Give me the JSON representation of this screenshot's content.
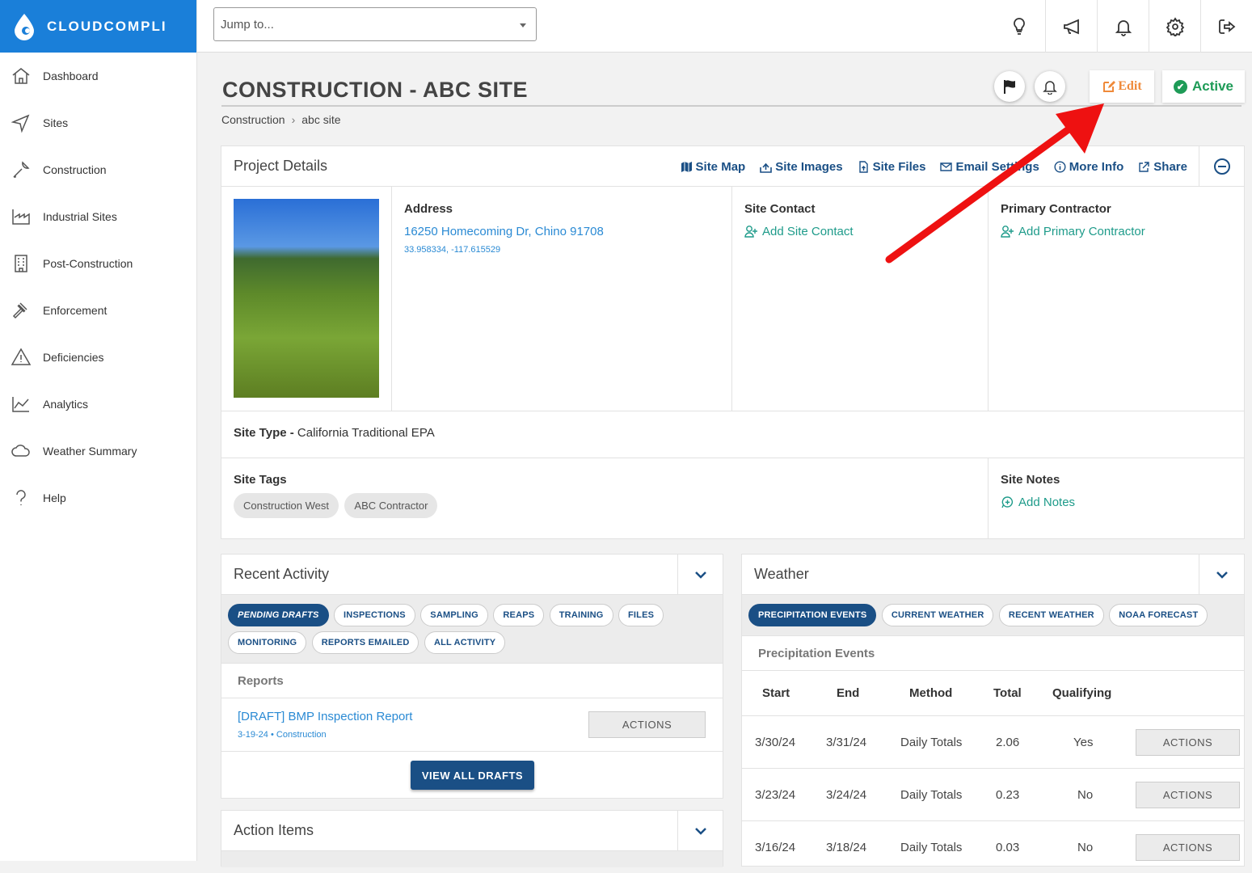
{
  "brand": {
    "name": "CLOUDCOMPLI"
  },
  "sidebar": {
    "items": [
      {
        "label": "Dashboard",
        "icon": "home-icon"
      },
      {
        "label": "Sites",
        "icon": "navigation-icon"
      },
      {
        "label": "Construction",
        "icon": "wrench-icon"
      },
      {
        "label": "Industrial Sites",
        "icon": "industry-icon"
      },
      {
        "label": "Post-Construction",
        "icon": "building-icon"
      },
      {
        "label": "Enforcement",
        "icon": "gavel-icon"
      },
      {
        "label": "Deficiencies",
        "icon": "warning-icon"
      },
      {
        "label": "Analytics",
        "icon": "chart-icon"
      },
      {
        "label": "Weather Summary",
        "icon": "cloud-icon"
      },
      {
        "label": "Help",
        "icon": "help-icon"
      }
    ]
  },
  "topbar": {
    "jump_placeholder": "Jump to...",
    "icons": [
      "lightbulb-icon",
      "megaphone-icon",
      "bell-icon",
      "gear-icon",
      "logout-icon"
    ]
  },
  "page": {
    "title": "CONSTRUCTION - ABC SITE",
    "edit_label": "Edit",
    "status_label": "Active",
    "breadcrumb": [
      "Construction",
      "abc site"
    ]
  },
  "project": {
    "title": "Project Details",
    "links": [
      "Site Map",
      "Site Images",
      "Site Files",
      "Email Settings",
      "More Info",
      "Share"
    ],
    "address_title": "Address",
    "address": "16250 Homecoming Dr, Chino 91708",
    "coords": "33.958334, -117.615529",
    "contact_title": "Site Contact",
    "contact_add": "Add Site Contact",
    "contractor_title": "Primary Contractor",
    "contractor_add": "Add Primary Contractor",
    "site_type_label": "Site Type - ",
    "site_type": "California Traditional EPA",
    "tags_title": "Site Tags",
    "tags": [
      "Construction West",
      "ABC Contractor"
    ],
    "notes_title": "Site Notes",
    "notes_add": "Add Notes"
  },
  "activity": {
    "title": "Recent Activity",
    "tabs": [
      "PENDING DRAFTS",
      "INSPECTIONS",
      "SAMPLING",
      "REAPS",
      "TRAINING",
      "FILES",
      "MONITORING",
      "REPORTS EMAILED",
      "ALL ACTIVITY"
    ],
    "section": "Reports",
    "report_title": "[DRAFT] BMP Inspection Report",
    "report_meta": "3-19-24 • Construction",
    "actions_label": "ACTIONS",
    "view_all": "VIEW ALL DRAFTS"
  },
  "action_items": {
    "title": "Action Items"
  },
  "weather": {
    "title": "Weather",
    "tabs": [
      "PRECIPITATION EVENTS",
      "CURRENT WEATHER",
      "RECENT WEATHER",
      "NOAA FORECAST"
    ],
    "section": "Precipitation Events",
    "columns": [
      "Start",
      "End",
      "Method",
      "Total",
      "Qualifying"
    ],
    "rows": [
      [
        "3/30/24",
        "3/31/24",
        "Daily Totals",
        "2.06",
        "Yes"
      ],
      [
        "3/23/24",
        "3/24/24",
        "Daily Totals",
        "0.23",
        "No"
      ],
      [
        "3/16/24",
        "3/18/24",
        "Daily Totals",
        "0.03",
        "No"
      ]
    ],
    "actions_label": "ACTIONS"
  },
  "colors": {
    "brand": "#1a7fd9",
    "navy": "#1a4f85",
    "edit": "#ef8a3a",
    "active": "#1e9b57",
    "arrow": "#ee1111"
  }
}
